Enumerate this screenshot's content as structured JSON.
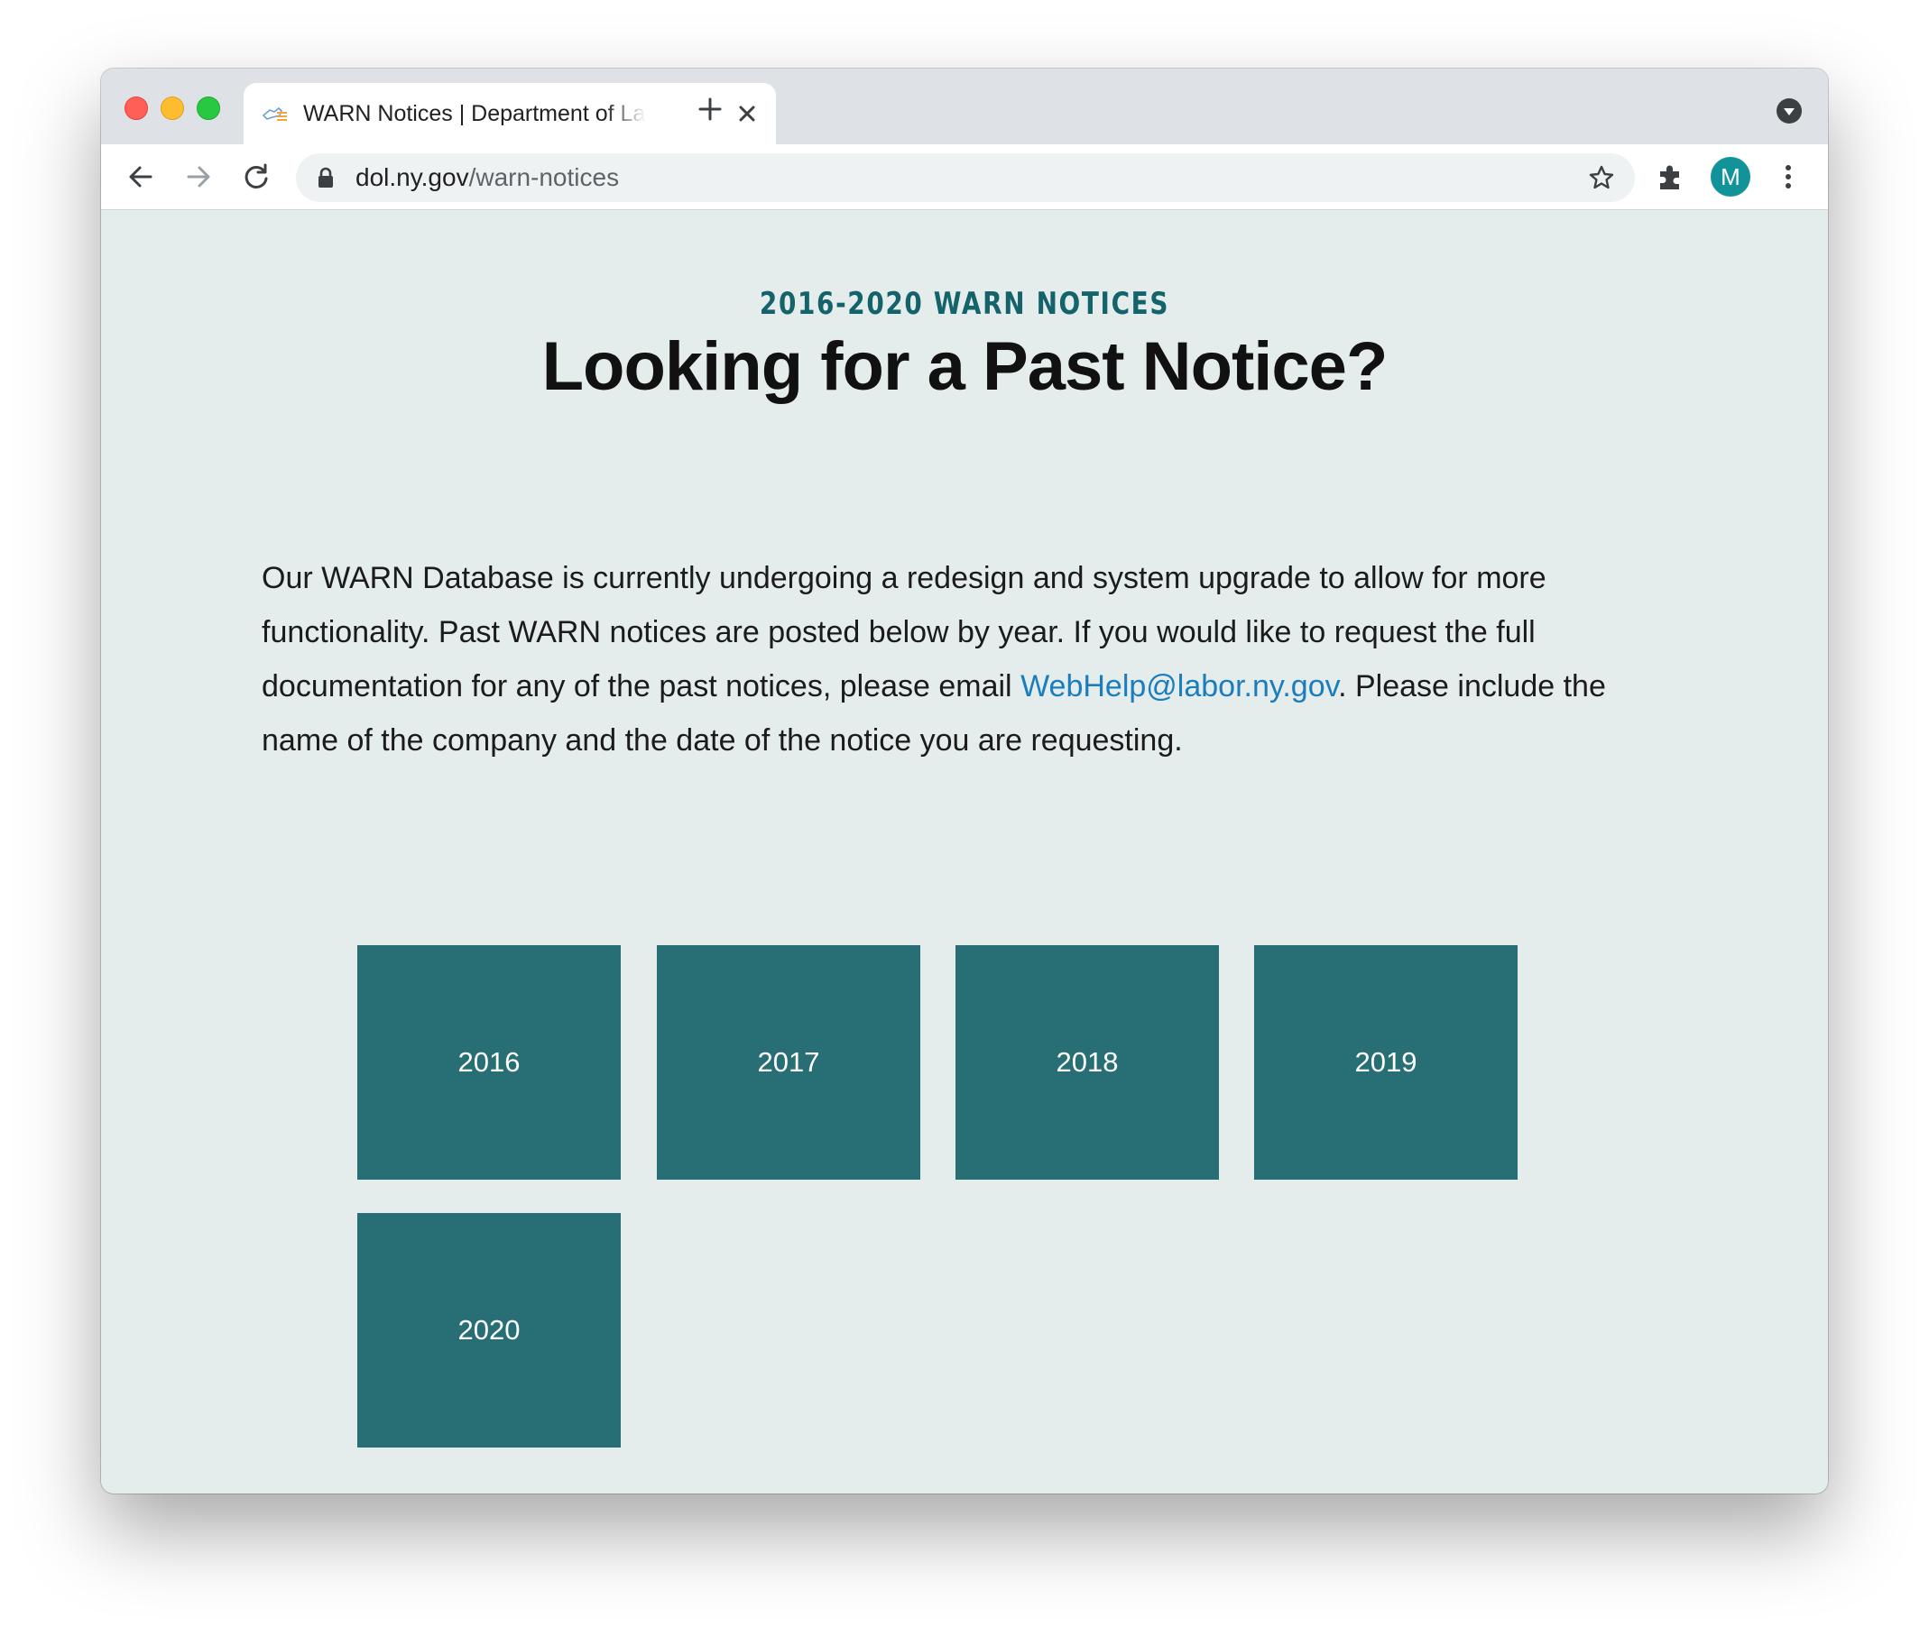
{
  "browser": {
    "tab": {
      "title": "WARN Notices | Department of Labor"
    },
    "address_bar": {
      "host": "dol.ny.gov",
      "path": "/warn-notices"
    },
    "profile_initial": "M",
    "traffic_lights": [
      "#ff5f57",
      "#febc2e",
      "#28c840"
    ]
  },
  "page": {
    "eyebrow": "2016-2020 WARN NOTICES",
    "heading": "Looking for a Past Notice?",
    "intro": {
      "before_link": "Our WARN Database is currently undergoing a redesign and system upgrade to allow for more functionality.  Past WARN notices are posted below by year. If you would like to request the full documentation for any of the past notices, please email ",
      "link_text": "WebHelp@labor.ny.gov",
      "after_link": ". Please include the name of the company and the date of the notice you are requesting."
    },
    "years": [
      "2016",
      "2017",
      "2018",
      "2019",
      "2020"
    ]
  },
  "colors": {
    "page_background": "#e4ecec",
    "accent_teal": "#14626a",
    "tile_background": "#276f75",
    "link": "#1a7dbc",
    "avatar": "#12939a"
  },
  "icons": {
    "tab_favicon": "ny-state-logo-icon",
    "tab_close": "close-icon",
    "new_tab": "plus-icon",
    "tab_search": "chevron-down-icon",
    "back": "arrow-left-icon",
    "forward": "arrow-right-icon",
    "reload": "reload-icon",
    "lock": "lock-icon",
    "bookmark": "star-icon",
    "extensions": "puzzle-icon",
    "menu": "kebab-menu-icon"
  }
}
